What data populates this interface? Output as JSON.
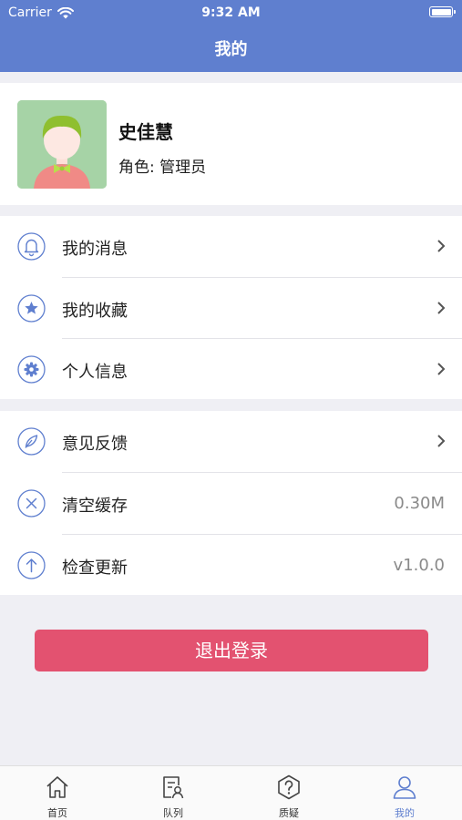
{
  "status_bar": {
    "carrier": "Carrier",
    "time": "9:32 AM"
  },
  "nav": {
    "title": "我的"
  },
  "profile": {
    "name": "史佳慧",
    "role_label": "角色:",
    "role_value": "管理员"
  },
  "menu_group_1": [
    {
      "label": "我的消息",
      "icon": "bell-icon"
    },
    {
      "label": "我的收藏",
      "icon": "star-icon"
    },
    {
      "label": "个人信息",
      "icon": "gear-icon"
    }
  ],
  "menu_group_2": [
    {
      "label": "意见反馈",
      "icon": "feather-icon"
    },
    {
      "label": "清空缓存",
      "icon": "clear-icon",
      "value": "0.30M"
    },
    {
      "label": "检查更新",
      "icon": "upload-arrow-icon",
      "value": "v1.0.0"
    }
  ],
  "logout": {
    "label": "退出登录"
  },
  "tabs": [
    {
      "label": "首页",
      "icon": "home-icon"
    },
    {
      "label": "队列",
      "icon": "queue-icon"
    },
    {
      "label": "质疑",
      "icon": "question-icon"
    },
    {
      "label": "我的",
      "icon": "user-icon"
    }
  ],
  "colors": {
    "primary": "#5f7fcf",
    "danger": "#e35270",
    "background": "#efeff4"
  }
}
